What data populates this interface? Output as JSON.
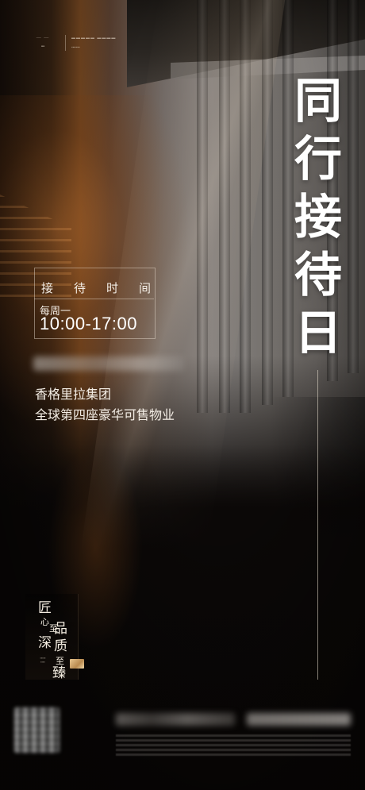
{
  "poster": {
    "title": "同行接待日",
    "reception": {
      "label": "接待时间",
      "day": "每周一",
      "time": "10:00-17:00"
    },
    "slogan": {
      "line1": "香格里拉集团",
      "line2": "全球第四座豪华可售物业"
    },
    "seal": {
      "chars": [
        "匠",
        "心",
        "至",
        "品",
        "深",
        "质",
        "至",
        "臻"
      ]
    },
    "colors": {
      "text": "#f4eee6",
      "accent_gold": "#c89a5c",
      "background": "#0b0807"
    }
  }
}
